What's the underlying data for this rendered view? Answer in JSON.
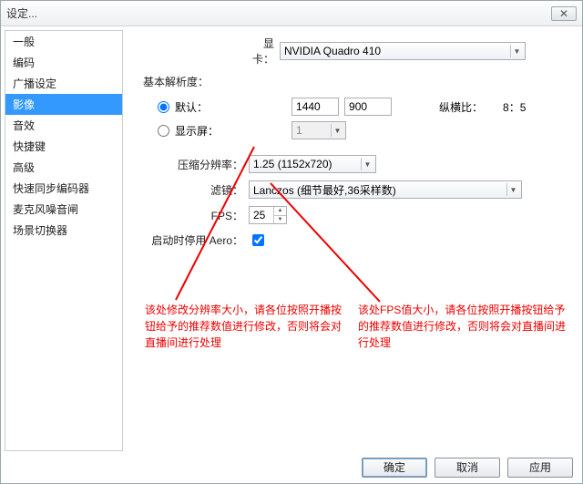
{
  "window": {
    "title": "设定..."
  },
  "sidebar": {
    "items": [
      {
        "label": "一般"
      },
      {
        "label": "编码"
      },
      {
        "label": "广播设定"
      },
      {
        "label": "影像",
        "selected": true
      },
      {
        "label": "音效"
      },
      {
        "label": "快捷键"
      },
      {
        "label": "高级"
      },
      {
        "label": "快速同步编码器"
      },
      {
        "label": "麦克风噪音闸"
      },
      {
        "label": "场景切换器"
      }
    ]
  },
  "gpu": {
    "label": "显卡：",
    "value": "NVIDIA Quadro 410"
  },
  "baseRes": {
    "group_label": "基本解析度：",
    "default_label": "默认：",
    "default_w": "1440",
    "default_h": "900",
    "aspect_label": "纵横比：",
    "aspect_value": "8：5",
    "monitor_label": "显示屏：",
    "monitor_value": "1"
  },
  "scale": {
    "label": "压缩分辨率：",
    "value": "1.25  (1152x720)"
  },
  "filter": {
    "label": "滤镜：",
    "value": "Lanczos (细节最好,36采样数)"
  },
  "fps": {
    "label": "FPS：",
    "value": "25"
  },
  "aero": {
    "label": "启动时停用 Aero：",
    "checked": true
  },
  "annotations": {
    "scale_note": "该处修改分辨率大小，请各位按照开播按钮给予的推荐数值进行修改，否则将会对直播间进行处理",
    "fps_note": "该处FPS值大小，请各位按照开播按钮给予的推荐数值进行修改，否则将会对直播间进行处理"
  },
  "buttons": {
    "ok": "确定",
    "cancel": "取消",
    "apply": "应用"
  }
}
